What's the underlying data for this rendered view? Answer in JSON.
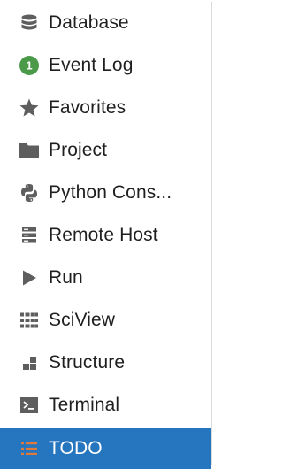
{
  "tool_windows": {
    "items": [
      {
        "label": "Database",
        "icon": "database-icon"
      },
      {
        "label": "Event Log",
        "icon": "event-log-badge-icon",
        "badge_count": "1"
      },
      {
        "label": "Favorites",
        "icon": "star-icon"
      },
      {
        "label": "Project",
        "icon": "folder-icon"
      },
      {
        "label": "Python Cons...",
        "icon": "python-icon"
      },
      {
        "label": "Remote Host",
        "icon": "remote-host-icon"
      },
      {
        "label": "Run",
        "icon": "run-icon"
      },
      {
        "label": "SciView",
        "icon": "sciview-icon"
      },
      {
        "label": "Structure",
        "icon": "structure-icon"
      },
      {
        "label": "Terminal",
        "icon": "terminal-icon"
      },
      {
        "label": "TODO",
        "icon": "todo-icon",
        "selected": true
      }
    ]
  },
  "colors": {
    "icon_gray": "#5e5e5e",
    "badge_green": "#4a9a4a",
    "selected_background": "#2675bf",
    "todo_icon_orange": "#e07a3a"
  }
}
